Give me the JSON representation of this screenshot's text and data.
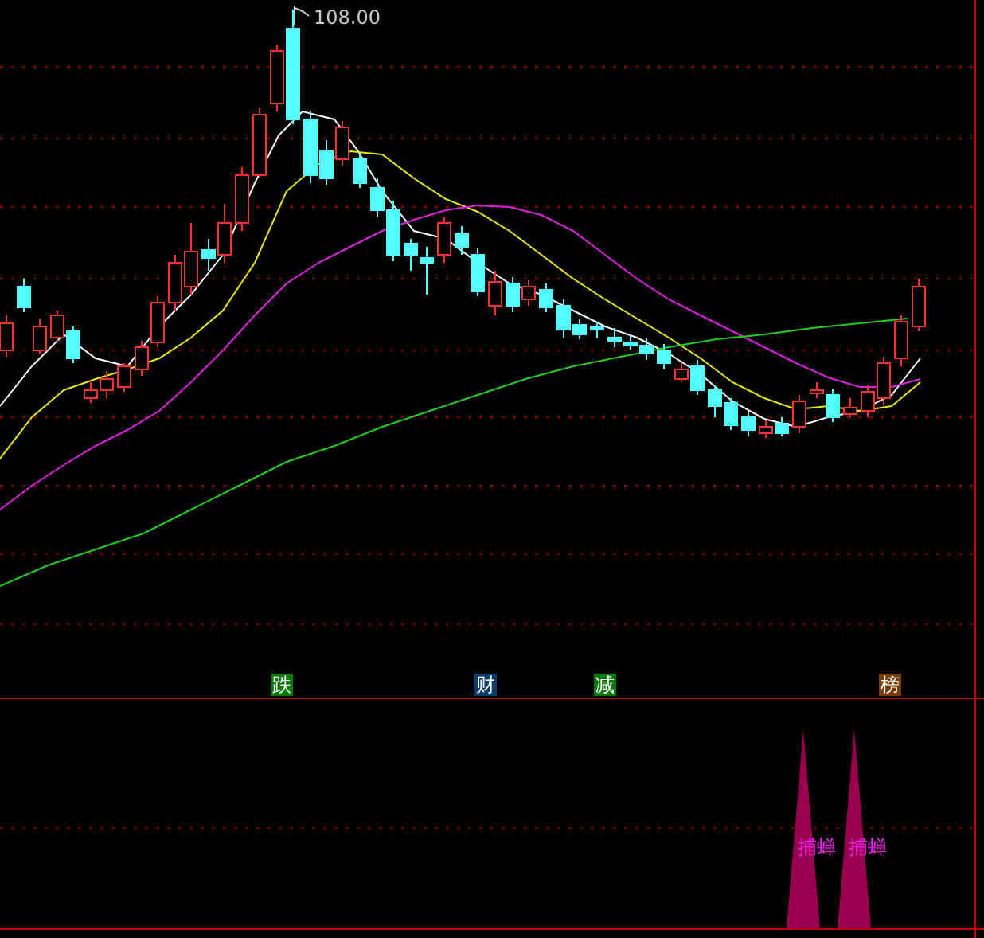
{
  "price_chart": {
    "high_label": "108.00",
    "tags": [
      {
        "text": "跌",
        "color": "#0a7a0a"
      },
      {
        "text": "财",
        "color": "#0c3c6e"
      },
      {
        "text": "减",
        "color": "#0a7a0a"
      },
      {
        "text": "榜",
        "color": "#7a3c08"
      }
    ]
  },
  "signal_panel": {
    "signals": [
      {
        "label": "捕蝉"
      },
      {
        "label": "捕蝉"
      }
    ]
  }
}
